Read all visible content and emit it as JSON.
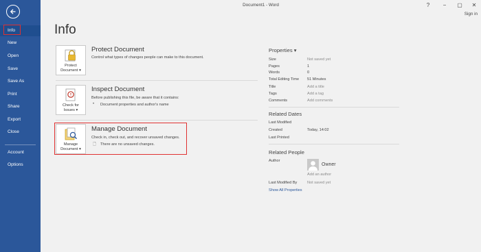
{
  "window": {
    "title": "Document1 - Word",
    "help": "?",
    "minimize": "−",
    "restore": "▢",
    "close": "✕",
    "sign_in": "Sign in"
  },
  "sidebar": {
    "items": [
      {
        "label": "Info"
      },
      {
        "label": "New"
      },
      {
        "label": "Open"
      },
      {
        "label": "Save"
      },
      {
        "label": "Save As"
      },
      {
        "label": "Print"
      },
      {
        "label": "Share"
      },
      {
        "label": "Export"
      },
      {
        "label": "Close"
      },
      {
        "label": "Account"
      },
      {
        "label": "Options"
      }
    ]
  },
  "main": {
    "title": "Info",
    "protect": {
      "btn_line1": "Protect",
      "btn_line2": "Document ▾",
      "title": "Protect Document",
      "desc": "Control what types of changes people can make to this document."
    },
    "inspect": {
      "btn_line1": "Check for",
      "btn_line2": "Issues ▾",
      "title": "Inspect Document",
      "desc": "Before publishing this file, be aware that it contains:",
      "item": "Document properties and author's name"
    },
    "manage": {
      "btn_line1": "Manage",
      "btn_line2": "Document ▾",
      "title": "Manage Document",
      "desc": "Check in, check out, and recover unsaved changes.",
      "item": "There are no unsaved changes."
    }
  },
  "properties": {
    "heading": "Properties ▾",
    "rows": [
      {
        "label": "Size",
        "value": "Not saved yet"
      },
      {
        "label": "Pages",
        "value": "1"
      },
      {
        "label": "Words",
        "value": "0"
      },
      {
        "label": "Total Editing Time",
        "value": "51 Minutes"
      },
      {
        "label": "Title",
        "value": "Add a title"
      },
      {
        "label": "Tags",
        "value": "Add a tag"
      },
      {
        "label": "Comments",
        "value": "Add comments"
      }
    ],
    "dates_heading": "Related Dates",
    "dates": [
      {
        "label": "Last Modified",
        "value": ""
      },
      {
        "label": "Created",
        "value": "Today, 14:02"
      },
      {
        "label": "Last Printed",
        "value": ""
      }
    ],
    "people_heading": "Related People",
    "author_label": "Author",
    "owner": "Owner",
    "add_author": "Add an author",
    "last_modified_by_label": "Last Modified By",
    "last_modified_by_value": "Not saved yet",
    "show_all": "Show All Properties"
  }
}
